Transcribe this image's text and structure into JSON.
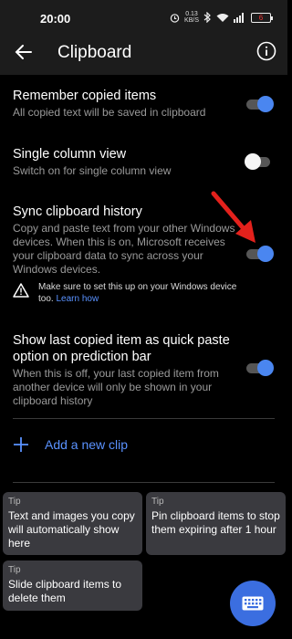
{
  "status_bar": {
    "time": "20:00",
    "data_speed_value": "0.13",
    "data_speed_unit": "KB/S",
    "battery": "6",
    "icons": [
      "alarm-icon",
      "bluetooth-icon",
      "wifi-icon",
      "signal-icon",
      "battery-icon"
    ]
  },
  "app_bar": {
    "title": "Clipboard",
    "back_icon": "arrow-back-icon",
    "info_icon": "info-icon"
  },
  "settings": [
    {
      "title": "Remember copied items",
      "description": "All copied text will be saved in clipboard",
      "enabled": true
    },
    {
      "title": "Single column view",
      "description": "Switch on for single column view",
      "enabled": false
    },
    {
      "title": "Sync clipboard history",
      "description": "Copy and paste text from your other Windows devices. When this is on, Microsoft receives your clipboard data to sync across your Windows devices.",
      "enabled": true
    },
    {
      "title": "Show last copied item as quick paste option on prediction bar",
      "description": "When this is off, your last copied item from another device will only be shown in your clipboard history",
      "enabled": true
    }
  ],
  "sync_warning": {
    "text": "Make sure to set this up on your Windows device too.",
    "link": "Learn how"
  },
  "add_clip": {
    "label": "Add a new clip"
  },
  "tips": [
    {
      "label": "Tip",
      "text": "Text and images you copy will automatically show here"
    },
    {
      "label": "Tip",
      "text": "Pin clipboard items to stop them expiring after 1 hour"
    },
    {
      "label": "Tip",
      "text": "Slide clipboard items to delete them"
    }
  ],
  "colors": {
    "accent": "#4a86f0",
    "link": "#5a92ff",
    "annotation_arrow": "#e3211c",
    "background": "#000000",
    "surface": "#1c1c1c",
    "tip_card": "#3a3a3f"
  },
  "fab": {
    "icon": "keyboard-icon"
  }
}
